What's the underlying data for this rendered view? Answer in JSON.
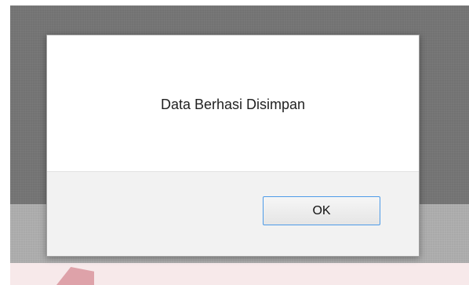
{
  "dialog": {
    "message": "Data Berhasi Disimpan",
    "ok_label": "OK"
  },
  "colors": {
    "backdrop_dark": "#727272",
    "backdrop_light": "#a9a9a9",
    "dialog_footer": "#f2f2f2",
    "button_focus_border": "#4d9be8"
  }
}
